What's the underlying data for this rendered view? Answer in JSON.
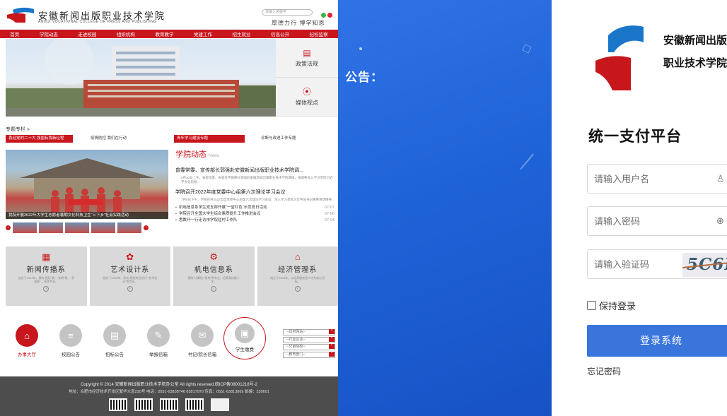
{
  "colors": {
    "brand_red": "#c8161d",
    "brand_blue": "#3a75dc",
    "panel_blue": "#1f63d8"
  },
  "site": {
    "name": "安徽新闻出版职业技术学院",
    "name_en": "ANHUI VOCATIONAL COLLEGE OF PRESS AND PUBLISHING",
    "search_placeholder": "请输入关键字",
    "motto": "厚德力行  博学知恩",
    "nav": [
      "首页",
      "学院动态",
      "走进校园",
      "组织机构",
      "教育教学",
      "党建工作",
      "招生就业",
      "信息公开",
      "纪检监察"
    ],
    "side": [
      {
        "icon": "document-icon",
        "label": "政策法规"
      },
      {
        "icon": "media-icon",
        "label": "媒体视点"
      }
    ],
    "special_title": "专题专栏",
    "special_tabs": [
      "喜迎党的二十大 强国有我新征程",
      "疫情防控 我们在行动",
      "青年学习建设专题",
      "诊断与改进工作专题"
    ],
    "photo_caption": "我院开展2022年大学生志愿者暑期文化科技卫生“三下乡”社会实践活动",
    "news": {
      "heading": "学院动态",
      "heading_en": "News",
      "lead": "曾委常委、宣传部长郭强赴安徽新闻出版职业技术学院调...",
      "lead_desc": "5月20日上午，省委常委、省委宣传部部长郭强赴安徽新闻出版职业技术学院调研，强调要深入学习贯彻习近平文化思想...",
      "lead2": "学院召开2022年度党委中心组第六次理论学习会议",
      "lead2_desc": "7月6日下午，学院召开2022年度党委中心组第六次理论学习会议，深入学习贯彻习近平总书记重要讲话精神...",
      "items": [
        {
          "title": "机电信息系学生党支部开展“一堂红色”示范党日活动",
          "date": "07-07"
        },
        {
          "title": "学院召开全国大学生综合素质提升工作推进会议",
          "date": "07-06"
        },
        {
          "title": "悉数开一行走访市学院驻村工作队",
          "date": "07-04"
        }
      ]
    },
    "depts": [
      {
        "icon": "news-icon",
        "name": "新闻传播系",
        "desc": "创办于2004年，拥有“国际”版、“新闻”版、“多媒体”... 系等专业。"
      },
      {
        "icon": "palette-icon",
        "name": "艺术设计系",
        "desc": "创办于2004年，系有“视觉传达设计”“艺术设计”等专业。"
      },
      {
        "icon": "gear-icon",
        "name": "机电信息系",
        "desc": "拥有“计算机”“机电”等专业，培养高技能人才。"
      },
      {
        "icon": "building-icon",
        "name": "经济管理系",
        "desc": "成立于2004年，以培养服务型人才为核心目标。"
      }
    ],
    "quick": [
      "办事大厅",
      "校园公告",
      "招标公告",
      "举报信箱",
      "书记/院长信箱",
      "学生缴费"
    ],
    "links": [
      "--政府网站--",
      "--行业企业--",
      "--兄弟院校--",
      "--教育部门--"
    ],
    "footer_line1": "Copyright © 2014 安徽新闻出版职业技术学院办公室 All rights reserved.皖ICP备08001218号-2",
    "footer_line2": "地址：合肥市经济技术开发区繁华大道220号 电话：0551-63838746 63817970 传真：0551-63813869 邮编：230601"
  },
  "announce": {
    "title": "公告："
  },
  "login": {
    "school_line1": "安徽新闻出版",
    "school_line2": "职业技术学院",
    "title": "统一支付平台",
    "username_placeholder": "请输入用户名",
    "password_placeholder": "请输入密码",
    "captcha_placeholder": "请输入验证码",
    "captcha_text": "5C6F",
    "remember_label": "保持登录",
    "submit_label": "登录系统",
    "forgot_label": "忘记密码"
  }
}
